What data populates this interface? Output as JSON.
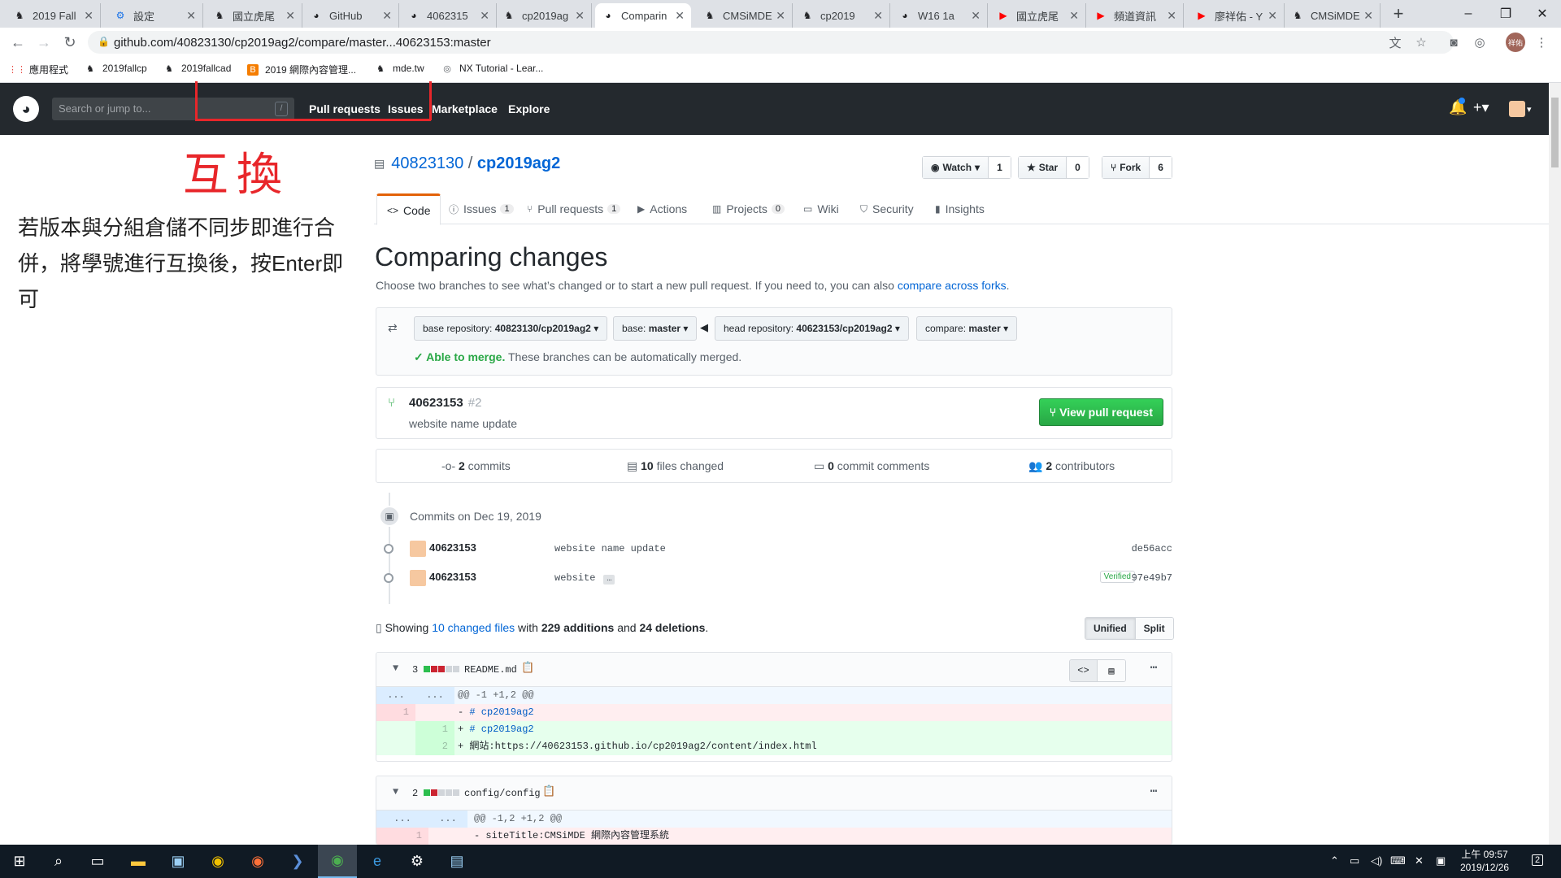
{
  "browser": {
    "tabs": [
      {
        "title": "2019 Fall",
        "icon": "w"
      },
      {
        "title": "設定",
        "icon": "gear"
      },
      {
        "title": "國立虎尾",
        "icon": "w"
      },
      {
        "title": "GitHub",
        "icon": "gh"
      },
      {
        "title": "4062315",
        "icon": "gh"
      },
      {
        "title": "cp2019ag",
        "icon": "w"
      },
      {
        "title": "Comparin",
        "icon": "gh",
        "active": true
      },
      {
        "title": "CMSiMDE",
        "icon": "w"
      },
      {
        "title": "cp2019",
        "icon": "w"
      },
      {
        "title": "W16 1a",
        "icon": "gh"
      },
      {
        "title": "國立虎尾",
        "icon": "yt"
      },
      {
        "title": "頻道資訊",
        "icon": "yt"
      },
      {
        "title": "廖祥佑 - Y",
        "icon": "yt"
      },
      {
        "title": "CMSiMDE",
        "icon": "w"
      }
    ],
    "new_tab": "+",
    "minimize": "–",
    "maximize": "❐",
    "close": "✕",
    "url": "github.com/40823130/cp2019ag2/compare/master...40623153:master",
    "avatar_text": "祥佑",
    "bookmarks": [
      {
        "label": "應用程式",
        "icon": "apps"
      },
      {
        "label": "2019fallcp",
        "icon": "w"
      },
      {
        "label": "2019fallcad",
        "icon": "w"
      },
      {
        "label": "2019 網際內容管理...",
        "icon": "blogger"
      },
      {
        "label": "mde.tw",
        "icon": "w"
      },
      {
        "label": "NX Tutorial - Lear...",
        "icon": "globe"
      }
    ]
  },
  "github": {
    "search_placeholder": "Search or jump to...",
    "search_key": "/",
    "nav": [
      "Pull requests",
      "Issues",
      "Marketplace",
      "Explore"
    ],
    "owner": "40823130",
    "separator": " / ",
    "repo": "cp2019ag2",
    "watch": {
      "label": "Watch",
      "count": "1"
    },
    "star": {
      "label": "Star",
      "count": "0"
    },
    "fork": {
      "label": "Fork",
      "count": "6"
    },
    "tabs": [
      {
        "label": "Code",
        "count": ""
      },
      {
        "label": "Issues",
        "count": "1"
      },
      {
        "label": "Pull requests",
        "count": "1"
      },
      {
        "label": "Actions",
        "count": ""
      },
      {
        "label": "Projects",
        "count": "0"
      },
      {
        "label": "Wiki",
        "count": ""
      },
      {
        "label": "Security",
        "count": ""
      },
      {
        "label": "Insights",
        "count": ""
      }
    ],
    "title": "Comparing changes",
    "subtitle": "Choose two branches to see what’s changed or to start a new pull request. If you need to, you can also ",
    "subtitle_link": "compare across forks",
    "subtitle_end": ".",
    "range": {
      "base_repo_label": "base repository:",
      "base_repo": "40823130/cp2019ag2",
      "base_label": "base:",
      "base": "master",
      "head_repo_label": "head repository:",
      "head_repo": "40623153/cp2019ag2",
      "compare_label": "compare:",
      "compare": "master",
      "merge_ok": "Able to merge.",
      "merge_msg": " These branches can be automatically merged."
    },
    "pr": {
      "title": "40623153",
      "number": "#2",
      "desc": "website name update",
      "button": "View pull request"
    },
    "stats": {
      "commits": "2",
      "commits_label": " commits",
      "files": "10",
      "files_label": " files changed",
      "comments": "0",
      "comments_label": " commit comments",
      "contributors": "2",
      "contributors_label": " contributors"
    },
    "commit_group": "Commits on Dec 19, 2019",
    "commits": [
      {
        "author": "40623153",
        "message": "website name update",
        "sha": "de56acc",
        "verified": ""
      },
      {
        "author": "40623153",
        "message": "website",
        "sha": "97e49b7",
        "verified": "Verified"
      }
    ],
    "diffstat": {
      "showing": "Showing ",
      "files_link": "10 changed files",
      "with": " with ",
      "additions": "229 additions",
      "and": " and ",
      "deletions": "24 deletions",
      "end": "."
    },
    "view_unified": "Unified",
    "view_split": "Split",
    "files": [
      {
        "count": "3",
        "name": "README.md",
        "hunk": "@@ -1 +1,2 @@",
        "lines": [
          {
            "type": "del",
            "n1": "1",
            "n2": "",
            "sign": "- ",
            "text": "# cp2019ag2"
          },
          {
            "type": "add",
            "n1": "",
            "n2": "1",
            "sign": "+ ",
            "text": "# cp2019ag2"
          },
          {
            "type": "add",
            "n1": "",
            "n2": "2",
            "sign": "+ ",
            "text": "網站:https://40623153.github.io/cp2019ag2/content/index.html"
          }
        ]
      },
      {
        "count": "2",
        "name": "config/config",
        "hunk": "@@ -1,2 +1,2 @@",
        "lines": [
          {
            "type": "del",
            "n1": "1",
            "n2": "",
            "sign": "- ",
            "text": "siteTitle:CMSiMDE 網際內容管理系統"
          }
        ]
      }
    ]
  },
  "annotation": {
    "char": "互換",
    "text": "若版本與分組倉儲不同步即進行合併，將學號進行互換後，按Enter即可"
  },
  "taskbar": {
    "time": "上午 09:57",
    "date": "2019/12/26",
    "notifications": "2"
  }
}
